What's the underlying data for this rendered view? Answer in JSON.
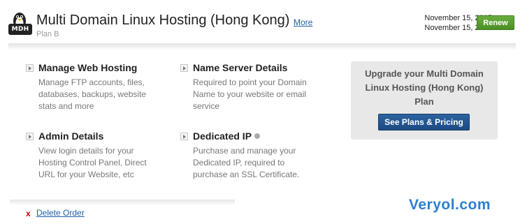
{
  "header": {
    "logo_badge": "MDH",
    "title": "Multi Domain Linux Hosting (Hong Kong)",
    "more_label": "More",
    "plan": "Plan B",
    "dates": [
      "November 15, 2015",
      "November 15, 2016"
    ],
    "renew_label": "Renew"
  },
  "features": [
    {
      "title": "Manage Web Hosting",
      "desc": "Manage FTP accounts, files, databases, backups, website stats and more"
    },
    {
      "title": "Name Server Details",
      "desc": "Required to point your Domain Name to your website or email service"
    },
    {
      "title": "Admin Details",
      "desc": "View login details for your Hosting Control Panel, Direct URL for your Website, etc"
    },
    {
      "title": "Dedicated IP",
      "desc": "Purchase and manage your Dedicated IP, required to purchase an SSL Certificate."
    }
  ],
  "upgrade": {
    "text": "Upgrade your Multi Domain Linux Hosting (Hong Kong) Plan",
    "button_label": "See Plans & Pricing"
  },
  "footer": {
    "delete_icon": "x",
    "delete_label": "Delete Order"
  },
  "watermark": "Veryol.com",
  "colors": {
    "link": "#1a5ea8",
    "renew_button": "#4b8f25",
    "plans_button": "#1d4a82",
    "delete_icon": "#cc0000",
    "watermark": "#2d7fd0"
  },
  "icons": {
    "logo": "linux-penguin-icon",
    "feature_arrow": "arrow-right-icon",
    "ip_status": "status-dot-icon"
  }
}
